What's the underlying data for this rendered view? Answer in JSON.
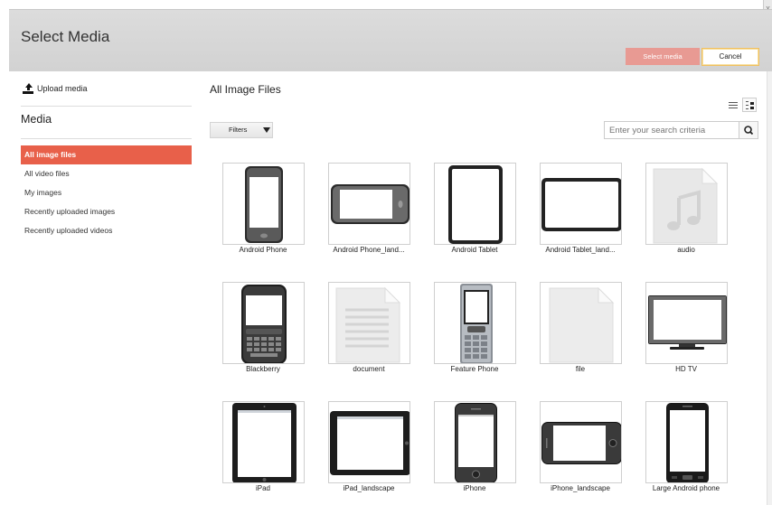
{
  "dialog": {
    "title": "Select Media",
    "close_glyph": "x",
    "select_label": "Select media",
    "cancel_label": "Cancel"
  },
  "sidebar": {
    "upload_label": "Upload media",
    "upload_icon": "upload-icon",
    "heading": "Media",
    "items": [
      {
        "label": "All image files",
        "active": true
      },
      {
        "label": "All video files",
        "active": false
      },
      {
        "label": "My images",
        "active": false
      },
      {
        "label": "Recently uploaded images",
        "active": false
      },
      {
        "label": "Recently uploaded videos",
        "active": false
      }
    ]
  },
  "main": {
    "title": "All Image Files",
    "filters_label": "Filters",
    "search_placeholder": "Enter your search criteria",
    "view_icons": [
      "list-view-icon",
      "detail-view-icon"
    ]
  },
  "tiles": [
    {
      "label": "Android Phone",
      "icon": "android-phone"
    },
    {
      "label": "Android Phone_land...",
      "icon": "android-phone-landscape"
    },
    {
      "label": "Android Tablet",
      "icon": "android-tablet"
    },
    {
      "label": "Android Tablet_land...",
      "icon": "android-tablet-landscape"
    },
    {
      "label": "audio",
      "icon": "audio-file"
    },
    {
      "label": "Blackberry",
      "icon": "blackberry"
    },
    {
      "label": "document",
      "icon": "document-file"
    },
    {
      "label": "Feature Phone",
      "icon": "feature-phone"
    },
    {
      "label": "file",
      "icon": "generic-file"
    },
    {
      "label": "HD TV",
      "icon": "hd-tv"
    },
    {
      "label": "iPad",
      "icon": "ipad"
    },
    {
      "label": "iPad_landscape",
      "icon": "ipad-landscape"
    },
    {
      "label": "iPhone",
      "icon": "iphone"
    },
    {
      "label": "iPhone_landscape",
      "icon": "iphone-landscape"
    },
    {
      "label": "Large Android phone",
      "icon": "large-android-phone"
    }
  ],
  "colors": {
    "accent": "#e8604a",
    "select_button": "#e89a93",
    "header_bg": "#d6d6d6"
  }
}
